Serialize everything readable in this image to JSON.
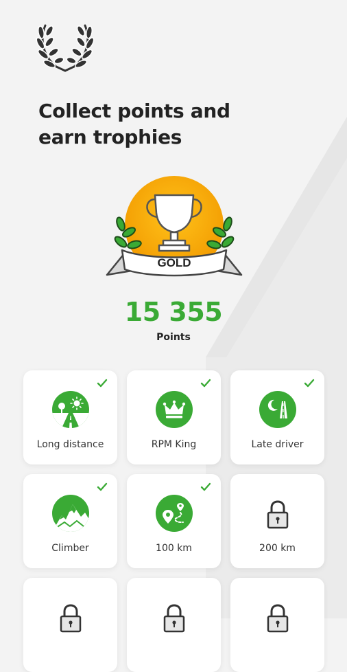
{
  "header": {
    "icon": "laurel-wreath-icon",
    "title_line1": "Collect points and",
    "title_line2": "earn trophies"
  },
  "badge": {
    "icon": "gold-trophy-badge-icon",
    "ribbon_text": "GOLD",
    "accent_color": "#f5a400"
  },
  "points": {
    "value": "15 355",
    "label": "Points",
    "color": "#3aaa35"
  },
  "trophies": [
    {
      "label": "Long distance",
      "icon": "road-sun-icon",
      "unlocked": true
    },
    {
      "label": "RPM King",
      "icon": "crown-icon",
      "unlocked": true
    },
    {
      "label": "Late driver",
      "icon": "moon-road-icon",
      "unlocked": true
    },
    {
      "label": "Climber",
      "icon": "mountain-icon",
      "unlocked": true
    },
    {
      "label": "100 km",
      "icon": "route-pin-icon",
      "unlocked": true
    },
    {
      "label": "200 km",
      "icon": "lock-icon",
      "unlocked": false
    },
    {
      "label": "",
      "icon": "lock-icon",
      "unlocked": false
    },
    {
      "label": "",
      "icon": "lock-icon",
      "unlocked": false
    },
    {
      "label": "",
      "icon": "lock-icon",
      "unlocked": false
    }
  ]
}
